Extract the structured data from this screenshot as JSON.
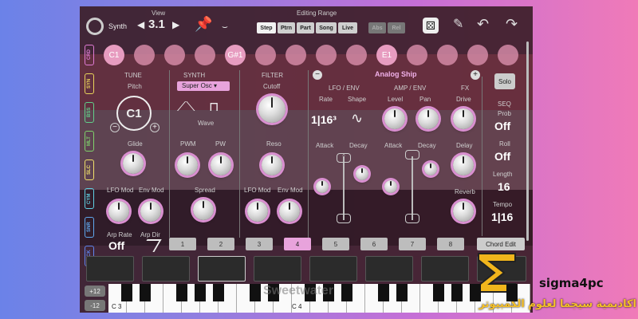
{
  "topbar": {
    "synth_label": "Synth",
    "view_label": "View",
    "view_value": "3.1",
    "editing_range_label": "Editing Range",
    "tabs": [
      "Step",
      "Ptrn",
      "Part",
      "Song",
      "Live"
    ],
    "extra_tabs": [
      "Abs",
      "Rel"
    ]
  },
  "side_tabs": [
    {
      "label": "CRD",
      "color": "#e07bd5"
    },
    {
      "label": "SYN",
      "color": "#e8d35a"
    },
    {
      "label": "BSS",
      "color": "#61d08a"
    },
    {
      "label": "MLT",
      "color": "#7fd26b"
    },
    {
      "label": "SLC",
      "color": "#f0e06a"
    },
    {
      "label": "CYM",
      "color": "#5fd0e3"
    },
    {
      "label": "SNR",
      "color": "#5fa7ee"
    },
    {
      "label": "KICK",
      "color": "#5f86ee"
    }
  ],
  "notes": [
    "C1",
    "",
    "",
    "",
    "G#1",
    "",
    "",
    "",
    "",
    "E1",
    "",
    "",
    "",
    ""
  ],
  "tune": {
    "section": "TUNE",
    "pitch_label": "Pitch",
    "pitch_value": "C1",
    "glide_label": "Glide",
    "lfo_mod_label": "LFO Mod",
    "env_mod_label": "Env Mod",
    "arp_rate_label": "Arp Rate",
    "arp_rate_value": "Off",
    "arp_dir_label": "Arp Dir"
  },
  "synth": {
    "section": "SYNTH",
    "osc_select": "Super Osc",
    "wave_label": "Wave",
    "pwm_label": "PWM",
    "pw_label": "PW",
    "spread_label": "Spread"
  },
  "filter": {
    "section": "FILTER",
    "cutoff_label": "Cutoff",
    "reso_label": "Reso",
    "lfo_mod_label": "LFO Mod",
    "env_mod_label": "Env Mod"
  },
  "preset": {
    "name": "Analog Ship"
  },
  "lfo_env": {
    "section": "LFO / ENV",
    "rate_label": "Rate",
    "rate_value": "1|16³",
    "shape_label": "Shape",
    "attack_label": "Attack",
    "decay_label": "Decay"
  },
  "amp_env": {
    "section": "AMP / ENV",
    "level_label": "Level",
    "pan_label": "Pan",
    "attack_label": "Attack",
    "decay_label": "Decay"
  },
  "fx": {
    "section": "FX",
    "drive_label": "Drive",
    "delay_label": "Delay",
    "reverb_label": "Reverb"
  },
  "seq": {
    "solo_label": "Solo",
    "section": "SEQ",
    "prob_label": "Prob",
    "prob_value": "Off",
    "roll_label": "Roll",
    "roll_value": "Off",
    "length_label": "Length",
    "length_value": "16",
    "tempo_label": "Tempo",
    "tempo_value": "1|16"
  },
  "patterns": [
    "1",
    "2",
    "3",
    "4",
    "5",
    "6",
    "7",
    "8"
  ],
  "chord_edit_label": "Chord Edit",
  "keyboard": {
    "octave_up": "+12",
    "octave_down": "-12",
    "c3_label": "C 3",
    "c4_label": "C 4"
  },
  "watermark": {
    "brand": "Sweetwater",
    "logo_text": "sigma4pc",
    "arabic_text": "اكاديمية سيجما لعلوم الكمبيوتر"
  }
}
